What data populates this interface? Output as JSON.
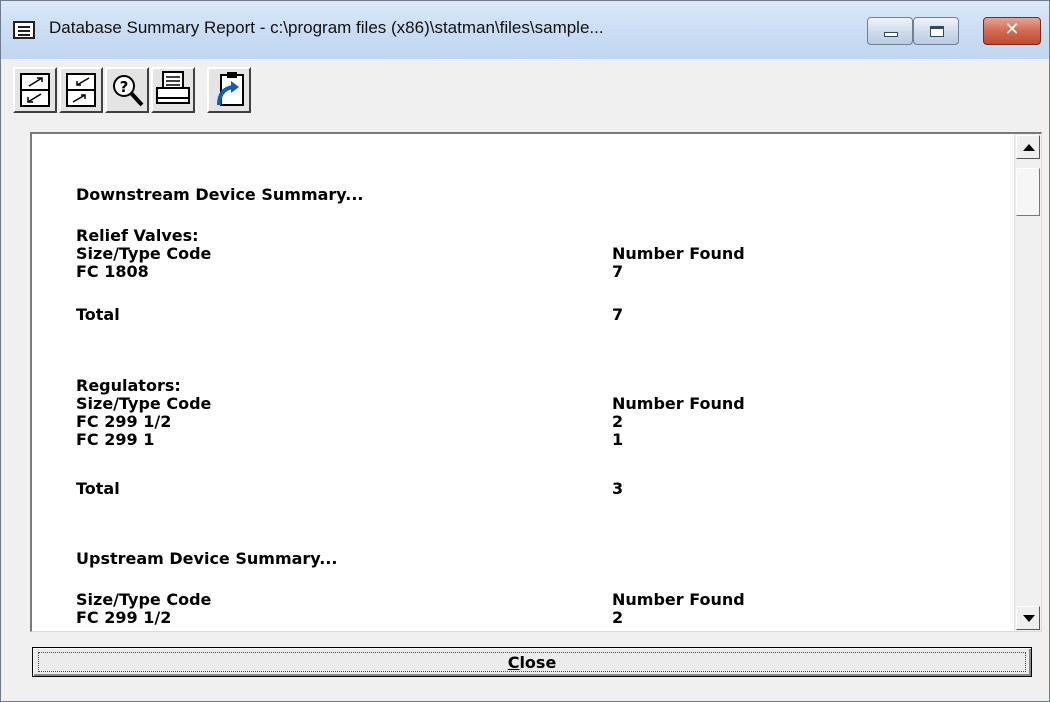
{
  "window": {
    "title": "Database Summary Report - c:\\program files (x86)\\statman\\files\\sample...",
    "title_icon": "window-menu-icon",
    "controls": {
      "minimize": "minimize-icon",
      "maximize": "maximize-icon",
      "close": "✕"
    }
  },
  "toolbar": {
    "buttons": [
      {
        "icon": "expand-page-icon"
      },
      {
        "icon": "shrink-page-icon"
      },
      {
        "icon": "help-magnifier-icon"
      },
      {
        "icon": "printer-icon"
      },
      {
        "icon": "export-clipboard-icon"
      }
    ]
  },
  "report": {
    "downstream_header": "Downstream Device Summary...",
    "relief": {
      "heading": "Relief Valves:",
      "col1_header": "Size/Type Code",
      "col2_header": "Number Found",
      "rows": [
        {
          "code": "FC 1808",
          "count": "7"
        }
      ],
      "total_label": "Total",
      "total_value": "7"
    },
    "regulators": {
      "heading": "Regulators:",
      "col1_header": "Size/Type Code",
      "col2_header": "Number Found",
      "rows": [
        {
          "code": "FC 299 1/2",
          "count": "2"
        },
        {
          "code": "FC 299 1",
          "count": "1"
        }
      ],
      "total_label": "Total",
      "total_value": "3"
    },
    "upstream_header": "Upstream Device Summary...",
    "upstream": {
      "col1_header": "Size/Type Code",
      "col2_header": "Number Found",
      "partial_row": {
        "code": "FC 299 1/2",
        "count": "2"
      }
    }
  },
  "footer": {
    "close_prefix": "",
    "close_mnemonic": "C",
    "close_rest": "lose"
  },
  "colors": {
    "titlebar": "#c9dcf3",
    "close_button": "#c8503a",
    "face": "#f0f0f0"
  }
}
